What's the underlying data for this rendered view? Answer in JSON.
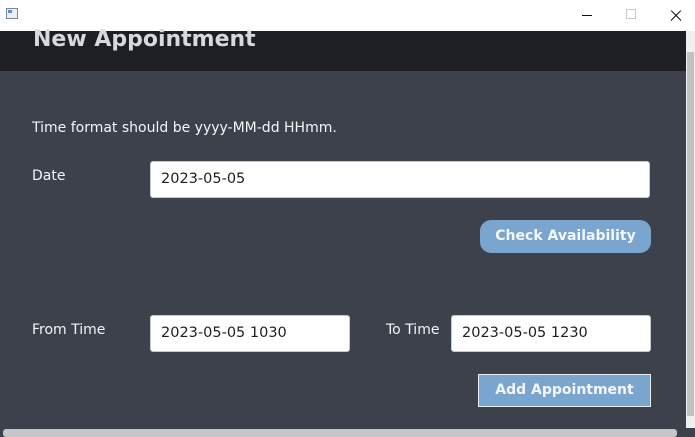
{
  "window": {
    "app_icon": "window-app-icon",
    "minimize_icon": "minimize-icon",
    "maximize_icon": "maximize-icon",
    "close_icon": "close-icon"
  },
  "header": {
    "title": "New Appointment"
  },
  "form": {
    "hint": "Time format should be yyyy-MM-dd HHmm.",
    "date_label": "Date",
    "date_value": "2023-05-05",
    "check_button": "Check Availability",
    "from_label": "From Time",
    "from_value": "2023-05-05 1030",
    "to_label": "To Time",
    "to_value": "2023-05-05 1230",
    "add_button": "Add Appointment"
  },
  "colors": {
    "background": "#3c414b",
    "header": "#1d1f24",
    "button": "#7aa5cf"
  }
}
